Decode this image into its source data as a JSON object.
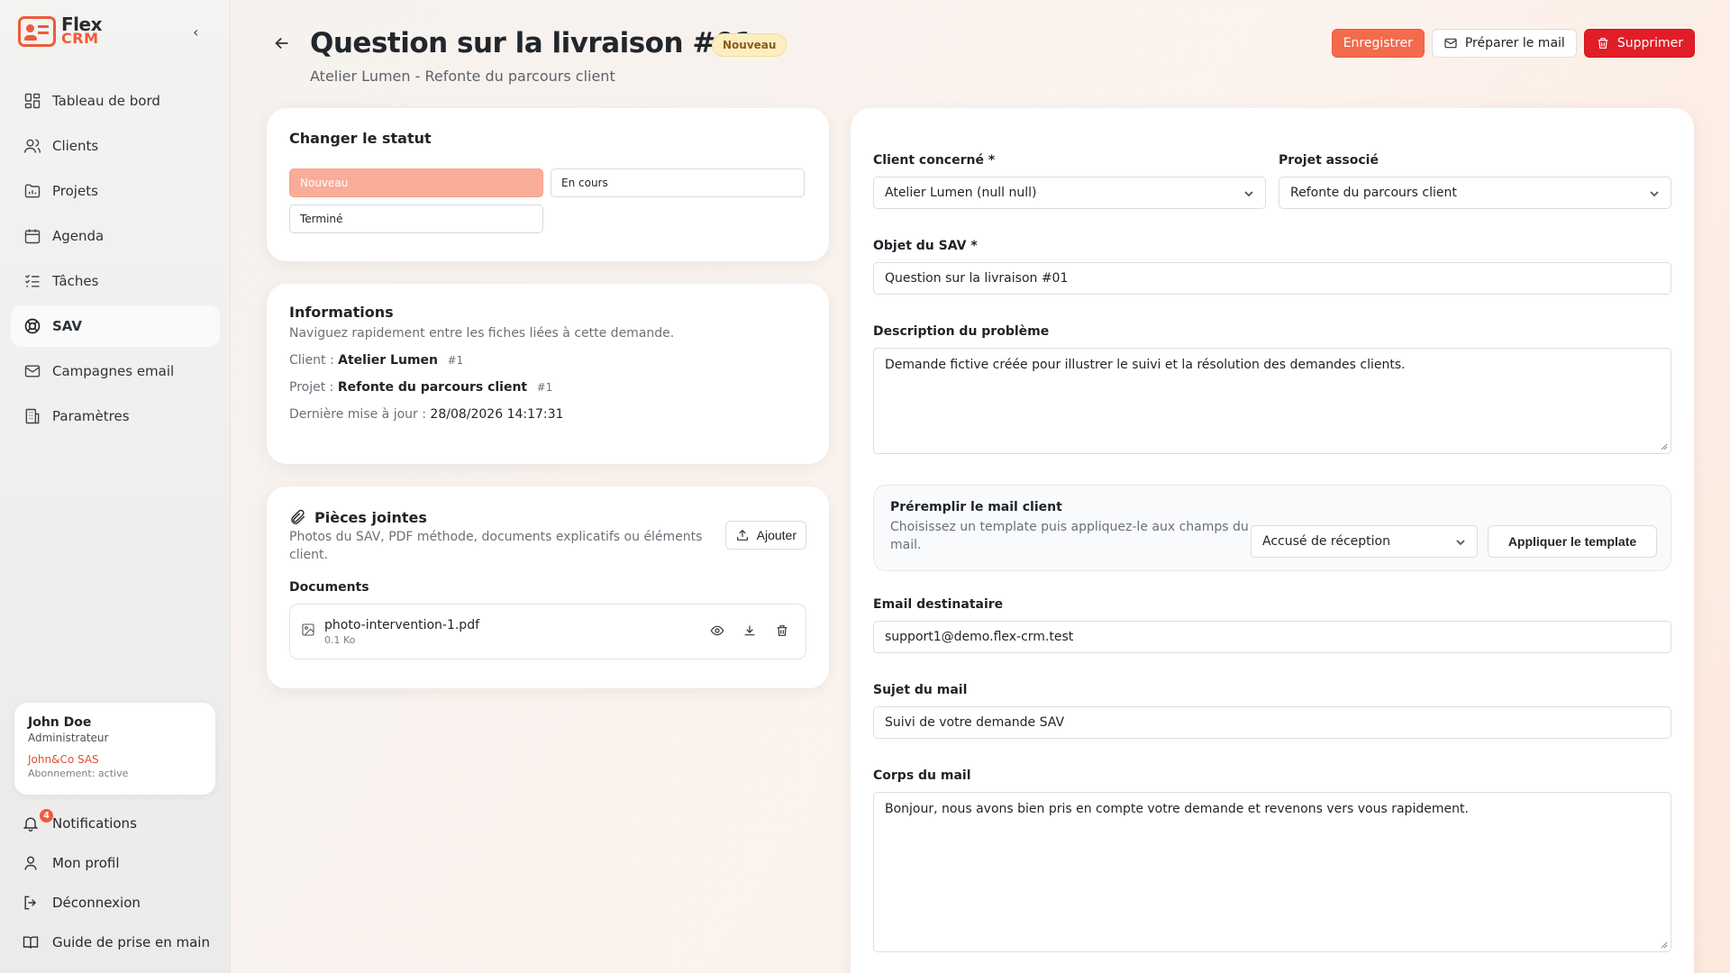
{
  "app": {
    "logo_line1": "Flex",
    "logo_line2": "CRM"
  },
  "sidebar": {
    "items": [
      {
        "label": "Tableau de bord",
        "icon": "dashboard-icon"
      },
      {
        "label": "Clients",
        "icon": "users-icon"
      },
      {
        "label": "Projets",
        "icon": "folder-chart-icon"
      },
      {
        "label": "Agenda",
        "icon": "calendar-icon"
      },
      {
        "label": "Tâches",
        "icon": "tasks-icon"
      },
      {
        "label": "SAV",
        "icon": "lifebuoy-icon",
        "active": true
      },
      {
        "label": "Campagnes email",
        "icon": "mail-icon"
      },
      {
        "label": "Paramètres",
        "icon": "building-icon"
      }
    ],
    "user": {
      "name": "John Doe",
      "role": "Administrateur",
      "org": "John&Co SAS",
      "subscription": "Abonnement: active"
    },
    "bottom": {
      "notifications": "Notifications",
      "notif_count": "4",
      "profile": "Mon profil",
      "logout": "Déconnexion",
      "guide": "Guide de prise en main"
    }
  },
  "header": {
    "title": "Question sur la livraison #01",
    "badge": "Nouveau",
    "subtitle": "Atelier Lumen - Refonte du parcours client",
    "save_label": "Enregistrer",
    "mail_label": "Préparer le mail",
    "delete_label": "Supprimer"
  },
  "status_card": {
    "title": "Changer le statut",
    "options": [
      "Nouveau",
      "En cours",
      "Terminé"
    ],
    "selected": "Nouveau"
  },
  "info_card": {
    "title": "Informations",
    "description": "Naviguez rapidement entre les fiches liées à cette demande.",
    "client_label": "Client :",
    "client_value": "Atelier Lumen",
    "client_ref": "#1",
    "project_label": "Projet :",
    "project_value": "Refonte du parcours client",
    "project_ref": "#1",
    "updated_label": "Dernière mise à jour :",
    "updated_value": "28/08/2026 14:17:31"
  },
  "files_card": {
    "title": "Pièces jointes",
    "description": "Photos du SAV, PDF méthode, documents explicatifs ou éléments client.",
    "add_label": "Ajouter",
    "documents_label": "Documents",
    "documents": [
      {
        "name": "photo-intervention-1.pdf",
        "size": "0.1 Ko"
      }
    ]
  },
  "form": {
    "client_label": "Client concerné *",
    "client_value": "Atelier Lumen (null null)",
    "project_label": "Projet associé",
    "project_value": "Refonte du parcours client",
    "subject_label": "Objet du SAV *",
    "subject_value": "Question sur la livraison #01",
    "description_label": "Description du problème",
    "description_value": "Demande fictive créée pour illustrer le suivi et la résolution des demandes clients.",
    "prefill_title": "Préremplir le mail client",
    "prefill_desc": "Choisissez un template puis appliquez-le aux champs du mail.",
    "template_value": "Accusé de réception",
    "apply_label": "Appliquer le template",
    "email_label": "Email destinataire",
    "email_value": "support1@demo.flex-crm.test",
    "mail_subject_label": "Sujet du mail",
    "mail_subject_value": "Suivi de votre demande SAV",
    "mail_body_label": "Corps du mail",
    "mail_body_value": "Bonjour, nous avons bien pris en compte votre demande et revenons vers vous rapidement."
  },
  "colors": {
    "accent": "#f36a4c",
    "danger": "#e11d27",
    "selected_status": "#f9ad98",
    "badge_bg": "#fbeec1"
  }
}
